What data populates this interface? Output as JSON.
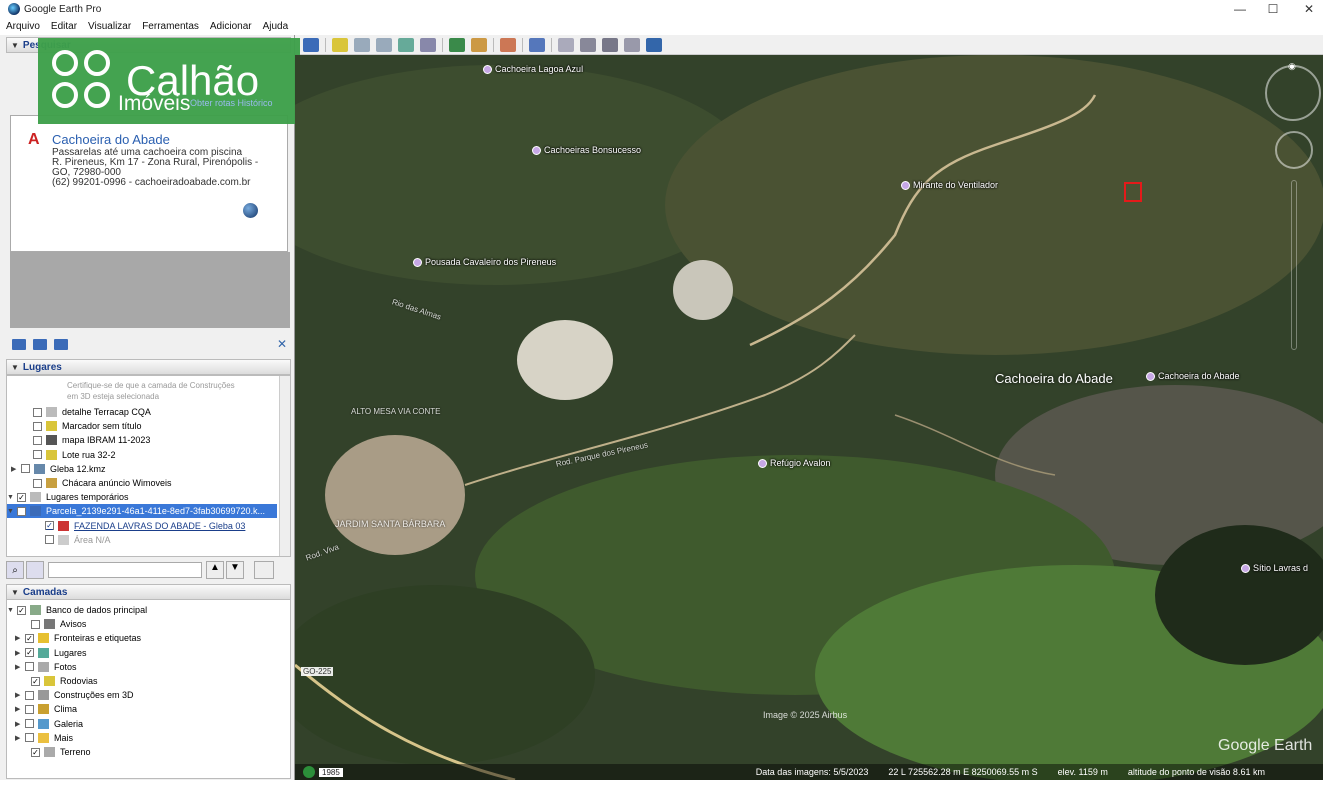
{
  "window": {
    "title": "Google Earth Pro",
    "min": "—",
    "max": "☐",
    "close": "✕"
  },
  "menu": [
    "Arquivo",
    "Editar",
    "Visualizar",
    "Ferramentas",
    "Adicionar",
    "Ajuda"
  ],
  "search_panel": {
    "header": "Pesquisar",
    "tabs": "Obter rotas  Histórico",
    "result": {
      "letter": "A",
      "title": "Cachoeira do Abade",
      "lines": [
        "Passarelas até uma cachoeira com piscina",
        "R. Pireneus, Km 17 - Zona Rural, Pirenópolis -",
        "GO, 72980-000",
        "(62) 99201-0996 - cachoeiradoabade.com.br"
      ]
    }
  },
  "logo": {
    "brand": "Calhão",
    "sub": "Imóveis"
  },
  "places": {
    "header": "Lugares",
    "notice": [
      "Certifique-se de que a camada de Construções",
      "em 3D esteja selecionada"
    ],
    "items": [
      {
        "label": "detalhe Terracap CQA",
        "checked": false,
        "expander": ""
      },
      {
        "label": "Marcador sem título",
        "checked": false,
        "expander": ""
      },
      {
        "label": "mapa IBRAM 11-2023",
        "checked": false,
        "expander": ""
      },
      {
        "label": "Lote rua 32-2",
        "checked": false,
        "expander": ""
      },
      {
        "label": "Gleba 12.kmz",
        "checked": false,
        "expander": "▶"
      },
      {
        "label": "Chácara anúncio Wimoveis",
        "checked": false,
        "expander": ""
      },
      {
        "label": "Lugares temporários",
        "checked": true,
        "expander": "▼"
      },
      {
        "label": "Parcela_2139e291-46a1-411e-8ed7-3fab30699720.k...",
        "checked": true,
        "expander": "▼"
      },
      {
        "label": "FAZENDA LAVRAS DO ABADE - Gleba 03",
        "checked": true,
        "expander": ""
      },
      {
        "label": "Área N/A",
        "checked": false,
        "expander": ""
      }
    ]
  },
  "layers": {
    "header": "Camadas",
    "items": [
      {
        "label": "Banco de dados principal",
        "checked": true,
        "expander": "▼"
      },
      {
        "label": "Avisos",
        "checked": false,
        "expander": ""
      },
      {
        "label": "Fronteiras e etiquetas",
        "checked": true,
        "expander": "▶"
      },
      {
        "label": "Lugares",
        "checked": true,
        "expander": "▶"
      },
      {
        "label": "Fotos",
        "checked": false,
        "expander": "▶"
      },
      {
        "label": "Rodovias",
        "checked": true,
        "expander": ""
      },
      {
        "label": "Construções em 3D",
        "checked": false,
        "expander": "▶"
      },
      {
        "label": "Clima",
        "checked": false,
        "expander": "▶"
      },
      {
        "label": "Galeria",
        "checked": false,
        "expander": "▶"
      },
      {
        "label": "Mais",
        "checked": false,
        "expander": "▶"
      },
      {
        "label": "Terreno",
        "checked": true,
        "expander": ""
      }
    ]
  },
  "map": {
    "pins": [
      {
        "label": "Cachoeira Lagoa Azul"
      },
      {
        "label": "Cachoeiras Bonsucesso"
      },
      {
        "label": "Mirante do Ventilador"
      },
      {
        "label": "Pousada Cavaleiro dos Pireneus"
      },
      {
        "label": "Cachoeira do Abade"
      },
      {
        "label": "Refúgio Avalon"
      },
      {
        "label": "Sítio Lavras d"
      }
    ],
    "big_label": "Cachoeira do Abade",
    "areas": [
      "JARDIM SANTA BÁRBARA",
      "ALTO MESA VIA CONTE"
    ],
    "roads": [
      "Rod. Parque dos Pireneus",
      "Rio das Almas",
      "GO-225",
      "Rod. Viva"
    ],
    "credit": "Image © 2025 Airbus",
    "watermark": "Google Earth",
    "year": "1985"
  },
  "status": {
    "date": "Data das imagens: 5/5/2023",
    "coords": "22 L 725562.28 m E 8250069.55 m S",
    "elev": "elev. 1159 m",
    "alt": "altitude do ponto de visão   8.61 km"
  }
}
